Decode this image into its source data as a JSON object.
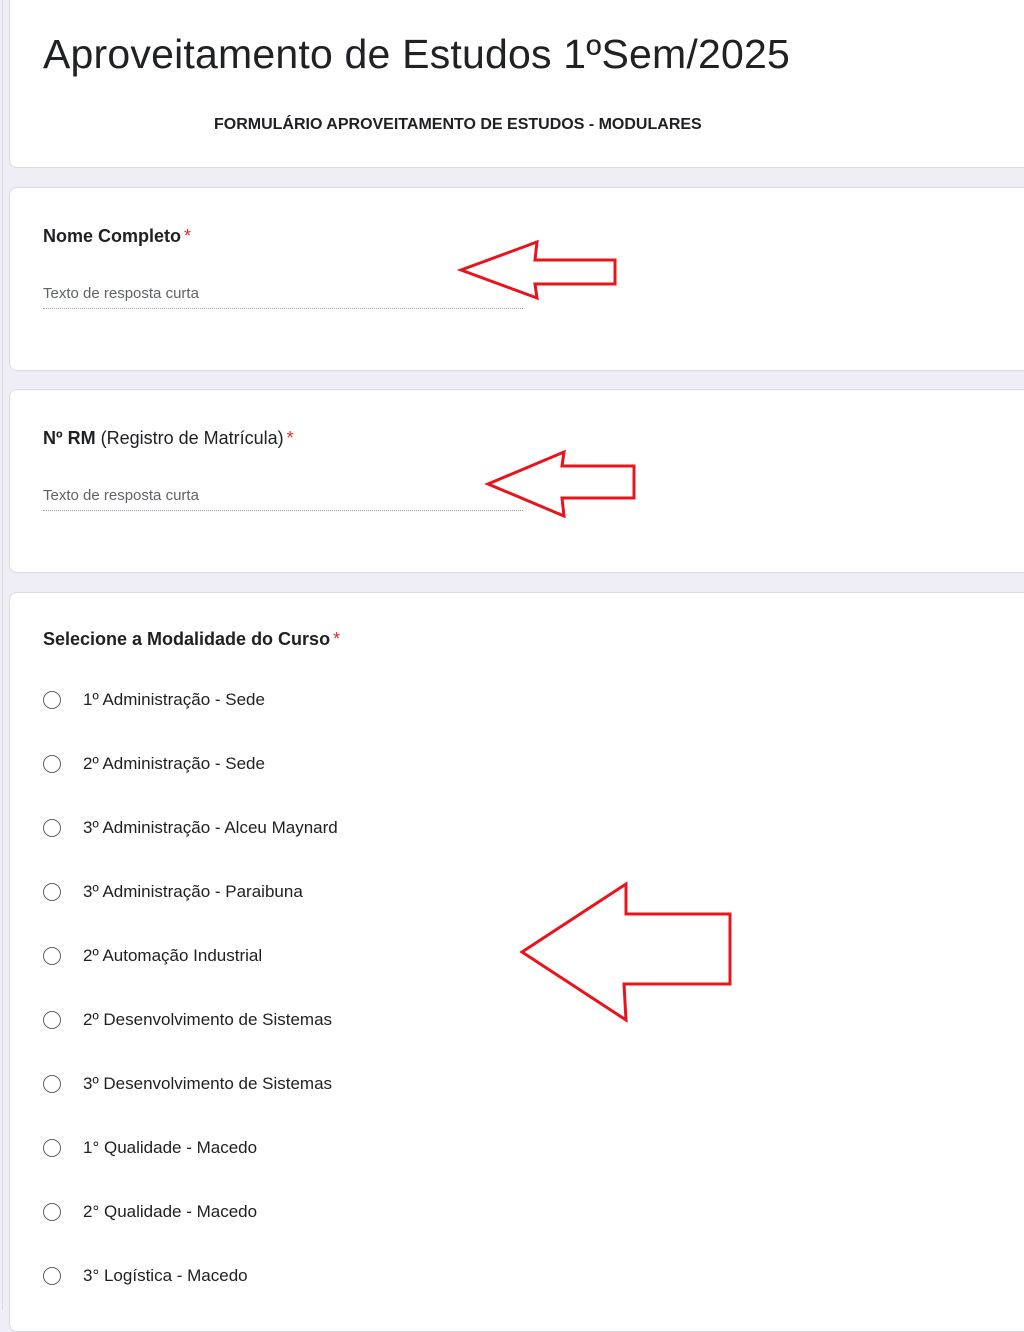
{
  "form": {
    "title": "Aproveitamento de Estudos 1ºSem/2025",
    "subtitle": "FORMULÁRIO APROVEITAMENTO DE ESTUDOS - MODULARES"
  },
  "questions": {
    "name": {
      "title": "Nome Completo",
      "required_mark": "*",
      "placeholder": "Texto de resposta curta"
    },
    "rm": {
      "title_bold": "Nº RM",
      "title_rest": " (Registro de Matrícula)",
      "required_mark": "*",
      "placeholder": "Texto de resposta curta"
    },
    "course": {
      "title": "Selecione a Modalidade do Curso",
      "required_mark": "*",
      "options": [
        "1º Administração - Sede",
        "2º Administração - Sede",
        "3º Administração - Alceu Maynard",
        "3º Administração - Paraibuna",
        "2º Automação Industrial",
        "2º Desenvolvimento de Sistemas",
        "3º Desenvolvimento de Sistemas",
        "1° Qualidade - Macedo",
        "2° Qualidade - Macedo",
        "3° Logística - Macedo"
      ]
    }
  },
  "colors": {
    "page_background": "#efeef6",
    "card_background": "#ffffff",
    "required_asterisk": "#d93025",
    "annotation_arrow": "#e8141b"
  },
  "icons": {
    "radio": "radio-unchecked-icon",
    "annotation": "red-arrow-left-icon"
  }
}
